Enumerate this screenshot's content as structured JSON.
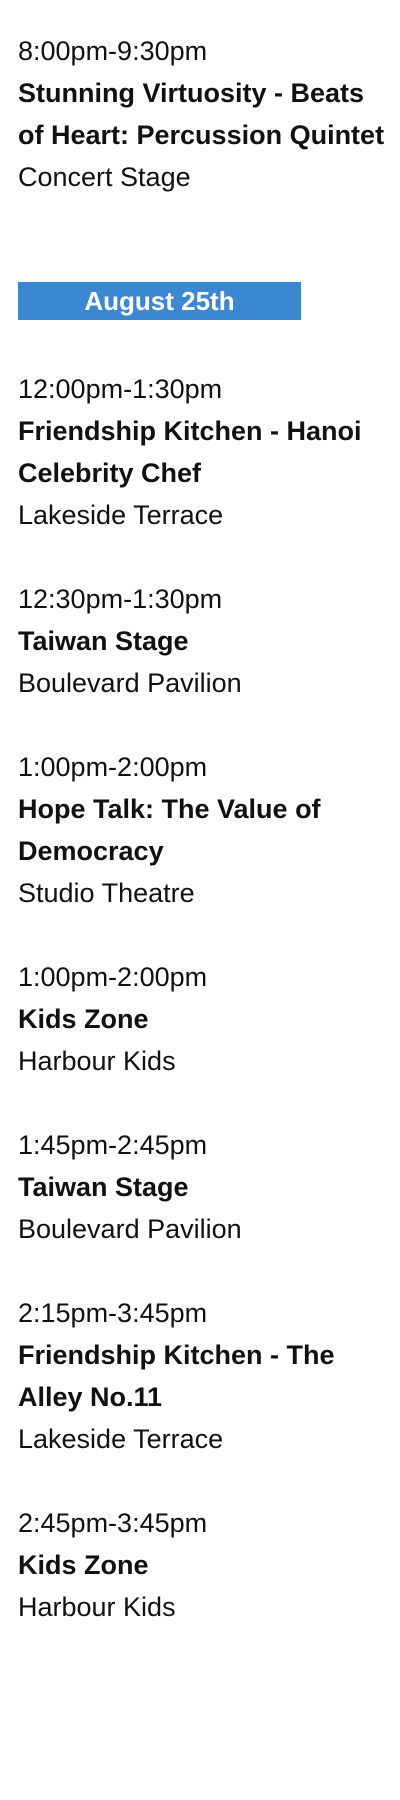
{
  "events_before": [
    {
      "time": "8:00pm-9:30pm",
      "title": "Stunning Virtuosity - Beats of Heart: Percussion Quintet",
      "venue": "Concert Stage"
    }
  ],
  "date_header": {
    "label": "August 25th",
    "bg_color": "#3b87d2"
  },
  "events_after": [
    {
      "time": "12:00pm-1:30pm",
      "title": "Friendship Kitchen - Hanoi Celebrity Chef",
      "venue": "Lakeside Terrace"
    },
    {
      "time": "12:30pm-1:30pm",
      "title": "Taiwan Stage",
      "venue": "Boulevard Pavilion"
    },
    {
      "time": "1:00pm-2:00pm",
      "title": "Hope Talk: The Value of Democracy",
      "venue": "Studio Theatre"
    },
    {
      "time": "1:00pm-2:00pm",
      "title": "Kids Zone",
      "venue": "Harbour Kids"
    },
    {
      "time": "1:45pm-2:45pm",
      "title": "Taiwan Stage",
      "venue": "Boulevard Pavilion"
    },
    {
      "time": "2:15pm-3:45pm",
      "title": "Friendship Kitchen - The Alley No.11",
      "venue": "Lakeside Terrace"
    },
    {
      "time": "2:45pm-3:45pm",
      "title": "Kids Zone",
      "venue": "Harbour Kids"
    }
  ]
}
